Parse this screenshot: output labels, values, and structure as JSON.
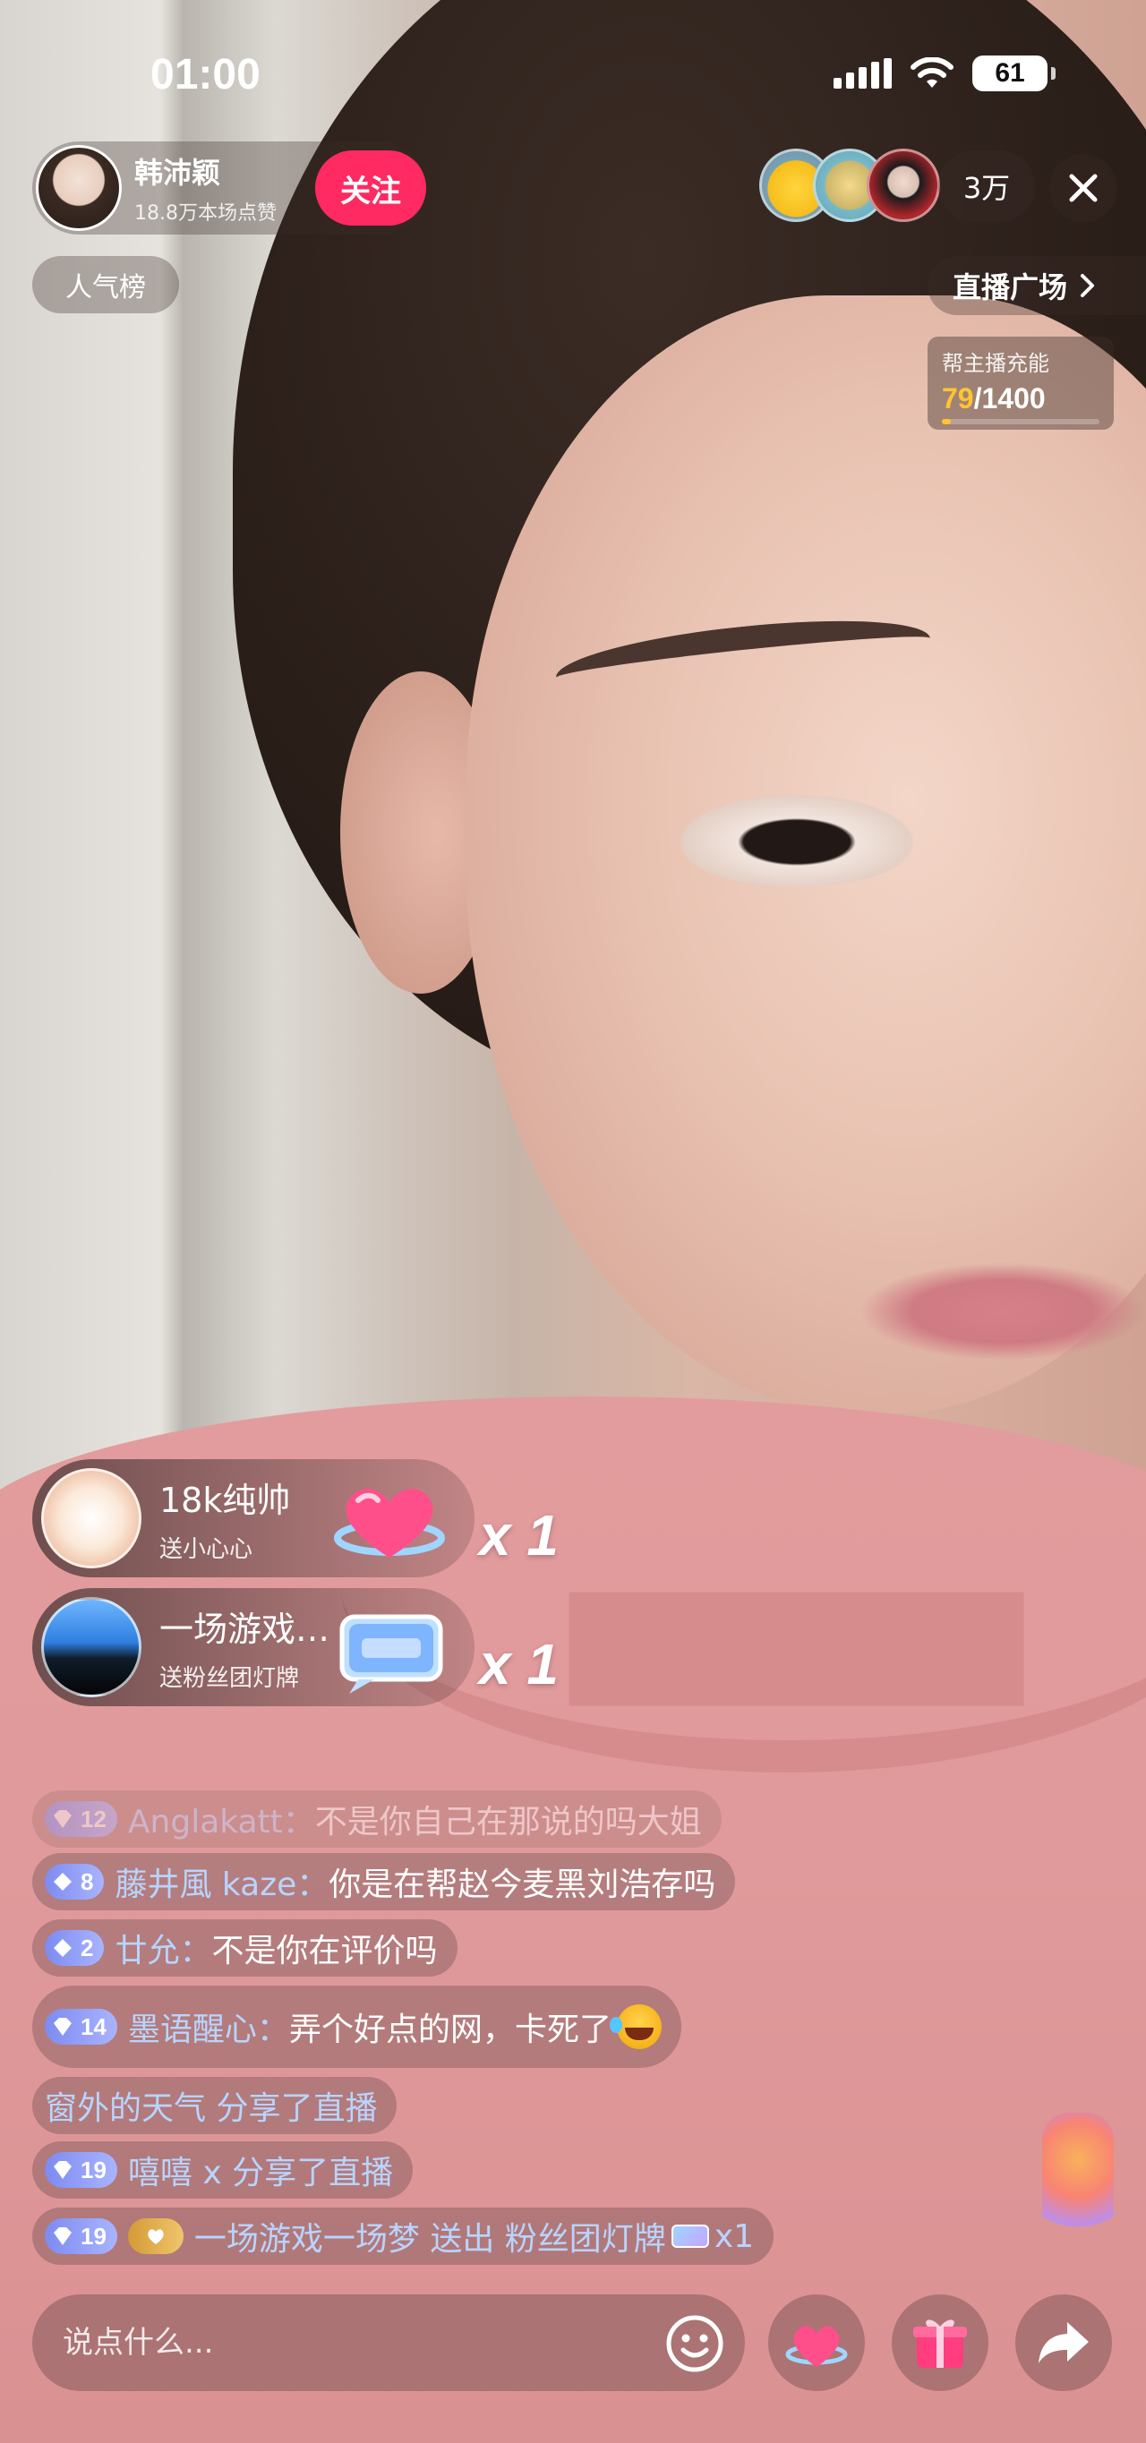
{
  "status_bar": {
    "time": "01:00",
    "battery": "61"
  },
  "host": {
    "name": "韩沛颖",
    "likes": "18.8万本场点赞",
    "follow_label": "关注"
  },
  "viewers": {
    "count": "3万"
  },
  "popularity_label": "人气榜",
  "plaza": {
    "label": "直播广场"
  },
  "charge": {
    "title": "帮主播充能",
    "current": "79",
    "separator": "/",
    "total": "1400",
    "progress": 0.056
  },
  "gifts": [
    {
      "user": "18k纯帅",
      "action": "送小心心",
      "count": "x 1"
    },
    {
      "user": "一场游戏…",
      "action": "送粉丝团灯牌",
      "count": "x 1"
    }
  ],
  "chat": [
    {
      "level": "12",
      "user": "Anglakatt：",
      "text": "不是你自己在那说的吗大姐"
    },
    {
      "level": "8",
      "user": "藤井風 kaze：",
      "text": "你是在帮赵今麦黑刘浩存吗"
    },
    {
      "level": "2",
      "user": "廿允：",
      "text": "不是你在评价吗"
    },
    {
      "level": "14",
      "user": "墨语醒心：",
      "text": "弄个好点的网，卡死了"
    },
    {
      "text": "窗外的天气 分享了直播"
    },
    {
      "level": "19",
      "text": "嘻嘻 x 分享了直播"
    },
    {
      "level": "19",
      "text_a": "一场游戏一场梦 送出 粉丝团灯牌",
      "text_b": "x1"
    }
  ],
  "input": {
    "placeholder": "说点什么..."
  },
  "icons": {
    "emoji": "smiley-icon",
    "heart": "heart-icon",
    "gift": "gift-box-icon",
    "share": "share-arrow-icon",
    "close": "close-icon",
    "chevron": "chevron-right-icon"
  },
  "colors": {
    "follow": "#ff2a62",
    "charge_accent": "#ffc531",
    "username": "#b9d4ff"
  }
}
